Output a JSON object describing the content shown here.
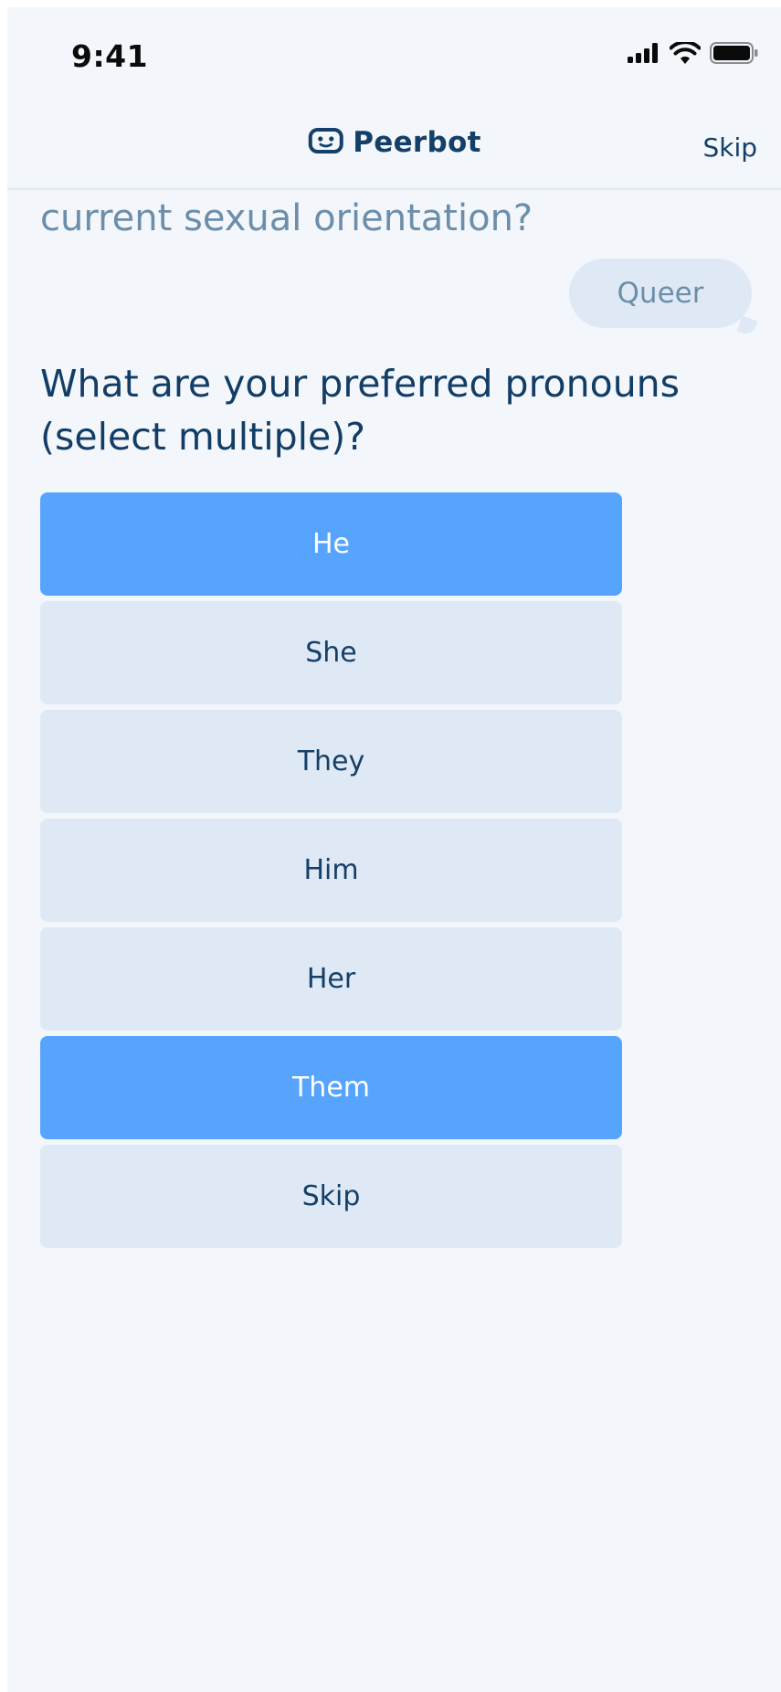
{
  "status_bar": {
    "time": "9:41",
    "icons": [
      "cellular-signal-icon",
      "wifi-icon",
      "battery-icon"
    ]
  },
  "header": {
    "brand_icon": "robot-face-icon",
    "brand_name": "Peerbot",
    "skip_label": "Skip"
  },
  "chat": {
    "previous_question_tail": "current sexual orientation?",
    "previous_answer": "Queer",
    "question": "What are your preferred pronouns (select multiple)?"
  },
  "options": [
    {
      "label": "He",
      "selected": true
    },
    {
      "label": "She",
      "selected": false
    },
    {
      "label": "They",
      "selected": false
    },
    {
      "label": "Him",
      "selected": false
    },
    {
      "label": "Her",
      "selected": false
    },
    {
      "label": "Them",
      "selected": true
    },
    {
      "label": "Skip",
      "selected": false
    }
  ],
  "colors": {
    "background": "#f3f7fc",
    "primary_text": "#143f68",
    "muted_text": "#6c8eaa",
    "option_default": "#dfe9f5",
    "option_selected": "#57a4ff"
  }
}
